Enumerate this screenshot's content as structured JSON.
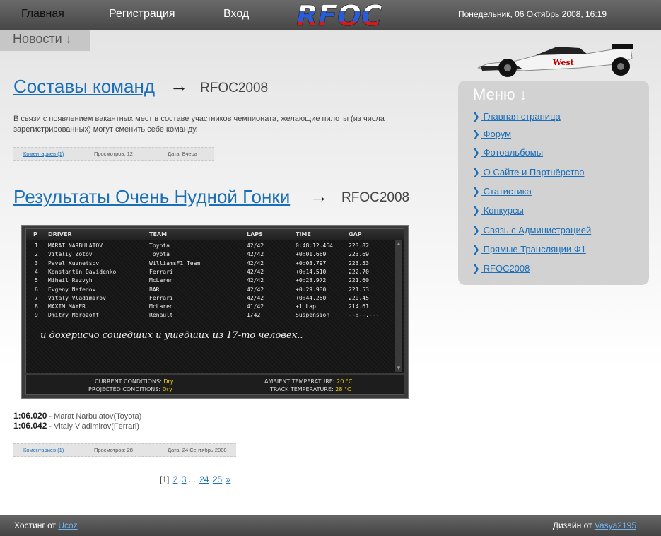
{
  "nav": {
    "home": "Главная",
    "register": "Регистрация",
    "login": "Вход",
    "logo_text": "RFOC",
    "date": "Понедельник, 06 Октябрь 2008, 16:19"
  },
  "news_tab": "Новости ↓",
  "articles": [
    {
      "title": "Составы команд",
      "arrow": "→",
      "category": "RFOC2008",
      "text": "В связи с появлением вакантных мест в составе участников чемпионата, желающие пилоты (из числа зарегистрированных) могут сменить себе команду.",
      "comments": "Коментариев (1)",
      "views": "Просмотров: 12",
      "date": "Дата: Вчера"
    },
    {
      "title": "Результаты Очень Нудной Гонки",
      "arrow": "→",
      "category": "RFOC2008",
      "comments": "Коментариев (1)",
      "views": "Просмотров: 28",
      "date": "Дата: 24 Сентябрь 2008",
      "results": {
        "headers": [
          "P",
          "DRIVER",
          "TEAM",
          "LAPS",
          "TIME",
          "GAP"
        ],
        "rows": [
          [
            "1",
            "MARAT NARBULATOV",
            "Toyota",
            "42/42",
            "0:48:12.464",
            "223.82"
          ],
          [
            "2",
            "Vitaliy Zotov",
            "Toyota",
            "42/42",
            "+0:01.669",
            "223.69"
          ],
          [
            "3",
            "Pavel Kuznetsov",
            "WilliamsF1 Team",
            "42/42",
            "+0:03.797",
            "223.53"
          ],
          [
            "4",
            "Konstantin Davidenko",
            "Ferrari",
            "42/42",
            "+0:14.510",
            "222.70"
          ],
          [
            "5",
            "Mihail Rezvyh",
            "McLaren",
            "42/42",
            "+0:28.972",
            "221.60"
          ],
          [
            "6",
            "Evgeny Nefedov",
            "BAR",
            "42/42",
            "+0:29.930",
            "221.53"
          ],
          [
            "7",
            "Vitaly Vladimirov",
            "Ferrari",
            "42/42",
            "+0:44.250",
            "220.45"
          ],
          [
            "8",
            "MAXIM MAYER",
            "McLaren",
            "41/42",
            "+1 Lap",
            "214.61"
          ],
          [
            "9",
            "Dmitry Morozoff",
            "Renault",
            "1/42",
            "Suspension",
            "--:--.---"
          ]
        ],
        "note": "и дохерисчо сошедших и ушедших из 17-то человек..",
        "current_conditions_label": "CURRENT CONDITIONS:",
        "current_conditions": "Dry",
        "projected_conditions_label": "PROJECTED CONDITIONS:",
        "projected_conditions": "Dry",
        "ambient_label": "AMBIENT TEMPERATURE:",
        "ambient": "20 °C",
        "track_label": "TRACK TEMPERATURE:",
        "track": "28 °C"
      },
      "laps": [
        {
          "time": "1:06.020",
          "who": " - Marat Narbulatov(Toyota)"
        },
        {
          "time": "1:06.042",
          "who": " - Vitaly Vladimirov(Ferrari)"
        }
      ]
    }
  ],
  "pagination": {
    "current": "[1]",
    "pages": [
      "2",
      "3"
    ],
    "ellipsis": "...",
    "tail": [
      "24",
      "25"
    ],
    "next": "»"
  },
  "menu": {
    "title": "Меню ↓",
    "items": [
      "Главная страница",
      "Форум",
      "Фотоальбомы",
      "О Сайте и Партнёрство",
      "Статистика",
      "Конкурсы",
      "Связь с Администрацией",
      "Прямые Трансляции Ф1",
      "RFOC2008"
    ]
  },
  "footer": {
    "hosting_label": "Хостинг от",
    "hosting_link": "Ucoz",
    "design_label": "Дизайн от",
    "design_link": "Vasya2195"
  },
  "colors": {
    "link": "#1a6fb8",
    "topbar": "#555555",
    "accent_yellow": "#f2d21a"
  }
}
